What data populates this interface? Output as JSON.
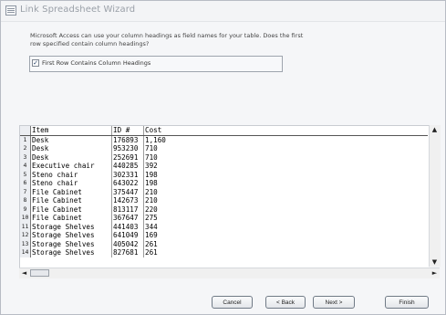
{
  "window": {
    "title": "Link Spreadsheet Wizard"
  },
  "intro": {
    "line1": "Microsoft Access can use your column headings as field names for your table. Does the first",
    "line2": "row specified contain column headings?"
  },
  "options": {
    "first_row_headings_label": "First Row Contains Column Headings",
    "first_row_headings_checked": true,
    "check_mark": "✓"
  },
  "grid": {
    "columns": [
      "Item",
      "ID #",
      "Cost"
    ],
    "rows": [
      {
        "n": "1",
        "item": "Desk",
        "id": "176893",
        "cost": "1,160"
      },
      {
        "n": "2",
        "item": "Desk",
        "id": "953230",
        "cost": "710"
      },
      {
        "n": "3",
        "item": "Desk",
        "id": "252691",
        "cost": "710"
      },
      {
        "n": "4",
        "item": "Executive chair",
        "id": "440285",
        "cost": "392"
      },
      {
        "n": "5",
        "item": "Steno chair",
        "id": "302331",
        "cost": "198"
      },
      {
        "n": "6",
        "item": "Steno chair",
        "id": "643022",
        "cost": "198"
      },
      {
        "n": "7",
        "item": "File Cabinet",
        "id": "375447",
        "cost": "210"
      },
      {
        "n": "8",
        "item": "File Cabinet",
        "id": "142673",
        "cost": "210"
      },
      {
        "n": "9",
        "item": "File Cabinet",
        "id": "813117",
        "cost": "220"
      },
      {
        "n": "10",
        "item": "File Cabinet",
        "id": "367647",
        "cost": "275"
      },
      {
        "n": "11",
        "item": "Storage Shelves",
        "id": "441403",
        "cost": "344"
      },
      {
        "n": "12",
        "item": "Storage Shelves",
        "id": "641049",
        "cost": "169"
      },
      {
        "n": "13",
        "item": "Storage Shelves",
        "id": "405042",
        "cost": "261"
      },
      {
        "n": "14",
        "item": "Storage Shelves",
        "id": "827681",
        "cost": "261"
      }
    ]
  },
  "scroll": {
    "up": "▲",
    "down": "▼",
    "left": "◄",
    "right": "►"
  },
  "buttons": {
    "cancel": "Cancel",
    "back": "< Back",
    "next": "Next >",
    "finish": "Finish"
  }
}
